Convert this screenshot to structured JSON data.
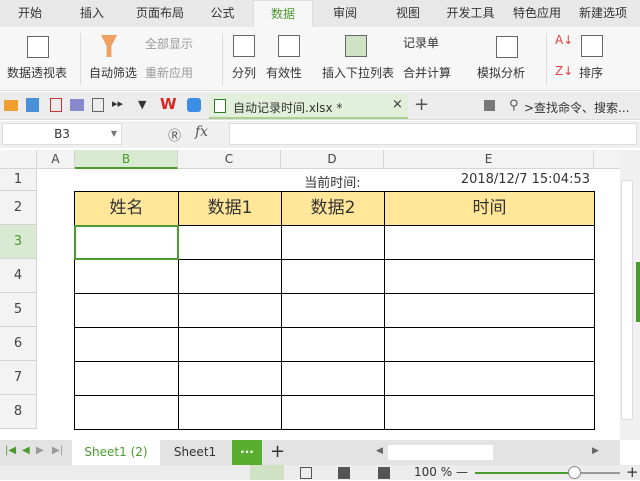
{
  "tabs": [
    "开始",
    "插入",
    "页面布局",
    "公式",
    "数据",
    "审阅",
    "视图",
    "开发工具",
    "特色应用",
    "新建选项"
  ],
  "active_tab": "数据",
  "ribbon": {
    "pivot": "数据透视表",
    "autofilter": "自动筛选",
    "show_all": "全部显示",
    "reapply": "重新应用",
    "split": "分列",
    "validity": "有效性",
    "insert_dropdown": "插入下拉列表",
    "record": "记录单",
    "consolidate": "合并计算",
    "what_if": "模拟分析",
    "sort": "排序"
  },
  "doc_tab": {
    "title": "自动记录时间.xlsx *",
    "close": "×",
    "new": "+"
  },
  "search": {
    "placeholder": ">查找命令、搜索..."
  },
  "formula_bar": {
    "cell_ref": "B3",
    "fx": "fx",
    "value": ""
  },
  "columns": [
    "A",
    "B",
    "C",
    "D",
    "E"
  ],
  "rows": [
    "1",
    "2",
    "3",
    "4",
    "5",
    "6",
    "7",
    "8"
  ],
  "sheet": {
    "d1": "当前时间:",
    "e1": "2018/12/7 15:04:53",
    "headers": [
      "姓名",
      "数据1",
      "数据2",
      "时间"
    ]
  },
  "sheets": [
    "Sheet1 (2)",
    "Sheet1"
  ],
  "sheet_more": "···",
  "sheet_add": "+",
  "zoom": "100 %",
  "zoom_percent": 100
}
